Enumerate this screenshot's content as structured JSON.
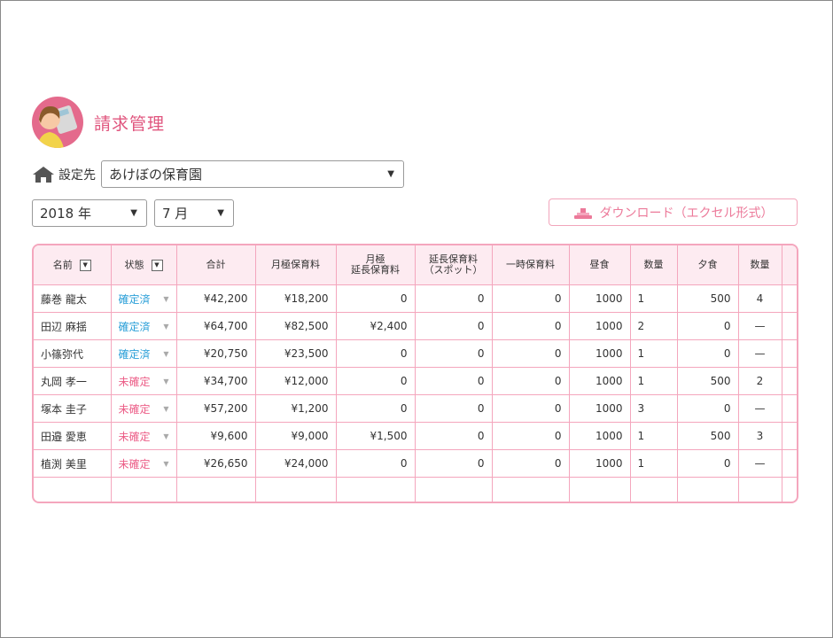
{
  "page": {
    "title": "請求管理"
  },
  "facility": {
    "label": "設定先",
    "selected": "あけぼの保育園"
  },
  "period": {
    "year": "2018 年",
    "month": "7 月"
  },
  "download": {
    "label": "ダウンロード（エクセル形式）"
  },
  "colors": {
    "accent": "#e0557e",
    "border": "#f4a6bd",
    "header_bg": "#fdebf1",
    "confirmed": "#2a9fd8",
    "unconfirmed": "#ec5d87"
  },
  "table": {
    "headers": {
      "name": "名前",
      "status": "状態",
      "total": "合計",
      "monthly": "月極保育料",
      "monthly_ext_1": "月極",
      "monthly_ext_2": "延長保育料",
      "spot_ext_1": "延長保育料",
      "spot_ext_2": "（スポット）",
      "temporary": "一時保育料",
      "lunch": "昼食",
      "lunch_qty": "数量",
      "dinner": "夕食",
      "dinner_qty": "数量"
    },
    "rows": [
      {
        "name": "藤巻 龍太",
        "status": "確定済",
        "status_type": "confirmed",
        "total": "¥42,200",
        "monthly": "¥18,200",
        "monthly_ext": "0",
        "spot_ext": "0",
        "temporary": "0",
        "lunch": "1000",
        "lunch_qty": "1",
        "dinner": "500",
        "dinner_qty": "4"
      },
      {
        "name": "田辺 麻揺",
        "status": "確定済",
        "status_type": "confirmed",
        "total": "¥64,700",
        "monthly": "¥82,500",
        "monthly_ext": "¥2,400",
        "spot_ext": "0",
        "temporary": "0",
        "lunch": "1000",
        "lunch_qty": "2",
        "dinner": "0",
        "dinner_qty": "—"
      },
      {
        "name": "小篠弥代",
        "status": "確定済",
        "status_type": "confirmed",
        "total": "¥20,750",
        "monthly": "¥23,500",
        "monthly_ext": "0",
        "spot_ext": "0",
        "temporary": "0",
        "lunch": "1000",
        "lunch_qty": "1",
        "dinner": "0",
        "dinner_qty": "—"
      },
      {
        "name": "丸岡 孝一",
        "status": "未確定",
        "status_type": "unconfirmed",
        "total": "¥34,700",
        "monthly": "¥12,000",
        "monthly_ext": "0",
        "spot_ext": "0",
        "temporary": "0",
        "lunch": "1000",
        "lunch_qty": "1",
        "dinner": "500",
        "dinner_qty": "2"
      },
      {
        "name": "塚本 圭子",
        "status": "未確定",
        "status_type": "unconfirmed",
        "total": "¥57,200",
        "monthly": "¥1,200",
        "monthly_ext": "0",
        "spot_ext": "0",
        "temporary": "0",
        "lunch": "1000",
        "lunch_qty": "3",
        "dinner": "0",
        "dinner_qty": "—"
      },
      {
        "name": "田邉 愛恵",
        "status": "未確定",
        "status_type": "unconfirmed",
        "total": "¥9,600",
        "monthly": "¥9,000",
        "monthly_ext": "¥1,500",
        "spot_ext": "0",
        "temporary": "0",
        "lunch": "1000",
        "lunch_qty": "1",
        "dinner": "500",
        "dinner_qty": "3"
      },
      {
        "name": "植渕 美里",
        "status": "未確定",
        "status_type": "unconfirmed",
        "total": "¥26,650",
        "monthly": "¥24,000",
        "monthly_ext": "0",
        "spot_ext": "0",
        "temporary": "0",
        "lunch": "1000",
        "lunch_qty": "1",
        "dinner": "0",
        "dinner_qty": "—"
      }
    ]
  }
}
